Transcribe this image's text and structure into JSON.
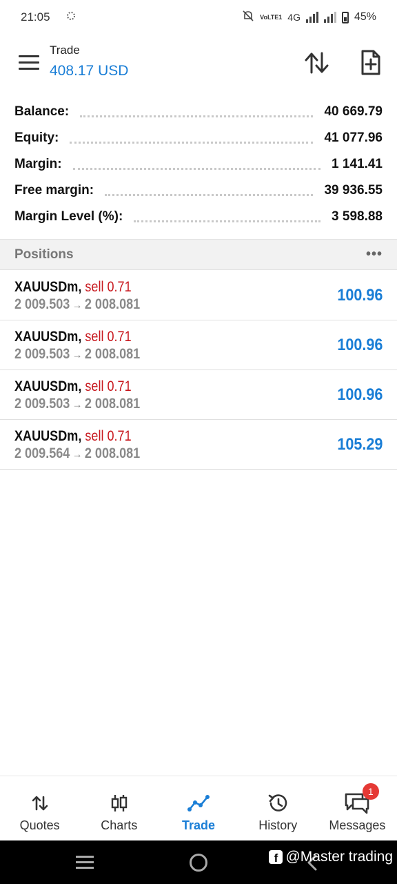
{
  "status_bar": {
    "time": "21:05",
    "network": "4G",
    "volte": "VoLTE1",
    "battery": "45%"
  },
  "header": {
    "title": "Trade",
    "balance": "408.17 USD"
  },
  "summary": [
    {
      "label": "Balance:",
      "value": "40 669.79"
    },
    {
      "label": "Equity:",
      "value": "41 077.96"
    },
    {
      "label": "Margin:",
      "value": "1 141.41"
    },
    {
      "label": "Free margin:",
      "value": "39 936.55"
    },
    {
      "label": "Margin Level (%):",
      "value": "3 598.88"
    }
  ],
  "positions": {
    "title": "Positions",
    "more": "•••",
    "items": [
      {
        "symbol": "XAUUSDm,",
        "side": "sell 0.71",
        "open": "2 009.503",
        "arrow": "→",
        "current": "2 008.081",
        "profit": "100.96"
      },
      {
        "symbol": "XAUUSDm,",
        "side": "sell 0.71",
        "open": "2 009.503",
        "arrow": "→",
        "current": "2 008.081",
        "profit": "100.96"
      },
      {
        "symbol": "XAUUSDm,",
        "side": "sell 0.71",
        "open": "2 009.503",
        "arrow": "→",
        "current": "2 008.081",
        "profit": "100.96"
      },
      {
        "symbol": "XAUUSDm,",
        "side": "sell 0.71",
        "open": "2 009.564",
        "arrow": "→",
        "current": "2 008.081",
        "profit": "105.29"
      }
    ]
  },
  "bottom_nav": {
    "items": [
      {
        "label": "Quotes",
        "icon": "quotes-icon"
      },
      {
        "label": "Charts",
        "icon": "charts-icon"
      },
      {
        "label": "Trade",
        "icon": "trade-icon"
      },
      {
        "label": "History",
        "icon": "history-icon"
      },
      {
        "label": "Messages",
        "icon": "messages-icon"
      }
    ],
    "active": "Trade",
    "messages_badge": "1"
  },
  "watermark": "@Master trading",
  "colors": {
    "accent": "#1a7ed6",
    "sell": "#c8181e",
    "badge": "#e53935"
  }
}
